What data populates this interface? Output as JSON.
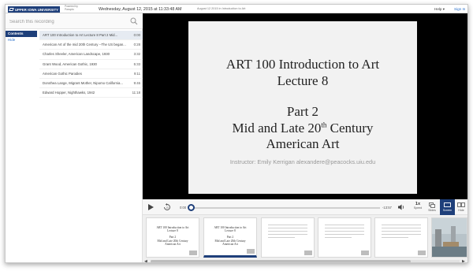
{
  "header": {
    "logo_text": "UPPER IOWA UNIVERSITY",
    "powered_by": "Powered by Panopto",
    "recording_date": "Wednesday, August 12, 2015 at 11:33:48 AM",
    "recording_title_small": "August 12 2015 in Introduction to Art",
    "help_label": "Help ▾",
    "signin_label": "Sign In"
  },
  "sidebar": {
    "search_placeholder": "Search this recording",
    "tabs": {
      "contents": "Contents",
      "hide": "Hide"
    },
    "items": [
      {
        "title": "ART 100 Introduction to Art Lecture 8 Part 2 Mid...",
        "time": "0:00"
      },
      {
        "title": "American Art of the mid 20th Century --The US began...",
        "time": "0:28"
      },
      {
        "title": "Charles Sheeler, American Landscape, 1930",
        "time": "3:32"
      },
      {
        "title": "Grant Wood, American Gothic, 1930",
        "time": "5:33"
      },
      {
        "title": "American Gothic Parodies",
        "time": "9:11"
      },
      {
        "title": "Dorothea Lange, Migrant Mother, Nipomo California...",
        "time": "9:46"
      },
      {
        "title": "Edward Hopper, Nighthawks, 1942",
        "time": "11:18"
      }
    ]
  },
  "slide": {
    "title_line1": "ART 100 Introduction to Art",
    "title_line2": "Lecture 8",
    "part": "Part 2",
    "subtitle_pre": "Mid and Late 20",
    "subtitle_sup": "th",
    "subtitle_post": " Century",
    "subtitle_line2": "American Art",
    "instructor": "Instructor: Emily Kerrigan alexandere@peacocks.uiu.edu"
  },
  "controls": {
    "elapsed": "0:00",
    "remaining": "-13:57",
    "progress_fraction": 0.0,
    "speed_value": "1x",
    "speed_label": "Speed",
    "slides_label": "Slides",
    "screen_label": "Screen",
    "hide_label": "Hide"
  },
  "thumbnails": [
    {
      "line1": "ART 100 Introduction to Art",
      "line2": "Lecture 8",
      "line3": "Part 2",
      "line4": "Mid and Late 20th Century",
      "line5": "American Art"
    },
    {
      "line1": "ART 100 Introduction to Art",
      "line2": "Lecture 8",
      "line3": "Part 2",
      "line4": "Mid and Late 20th Century",
      "line5": "American Art"
    }
  ],
  "colors": {
    "brand_navy": "#1e3f7a",
    "link_blue": "#2a6fc9",
    "player_bg": "#000000",
    "slide_bg": "#f2f2f2"
  },
  "icons": [
    "search-icon",
    "play-icon",
    "rewind-icon",
    "volume-icon",
    "slides-icon",
    "screen-icon",
    "hide-icon"
  ]
}
